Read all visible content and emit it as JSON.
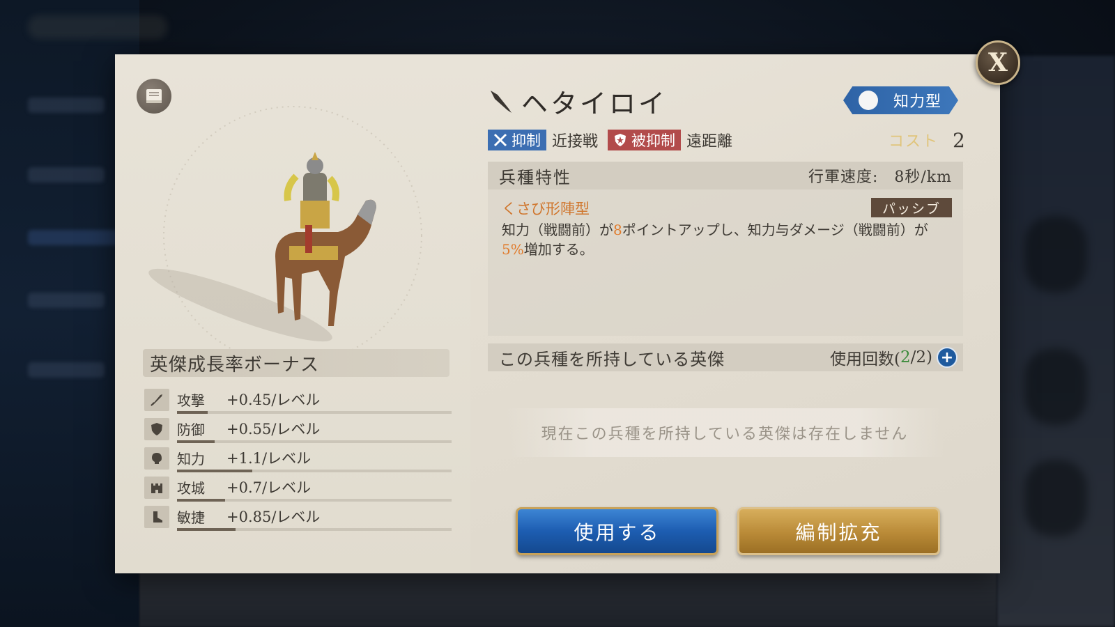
{
  "unit": {
    "name": "ヘタイロイ",
    "type_label": "知力型",
    "advantage_label": "抑制",
    "advantage_target": "近接戦",
    "disadvantage_label": "被抑制",
    "disadvantage_target": "遠距離",
    "cost_label": "コスト",
    "cost_value": "2"
  },
  "trait": {
    "title": "兵種特性",
    "speed": "行軍速度:　8秒/km",
    "skill_name": "くさび形陣型",
    "skill_kind": "パッシブ",
    "desc_part1": "知力（戦闘前）が",
    "desc_num1": "8",
    "desc_part2": "ポイントアップし、知力与ダメージ（戦闘前）が",
    "desc_num2": "5%",
    "desc_part3": "増加する。"
  },
  "owners": {
    "title": "この兵種を所持している英傑",
    "uses_prefix": "使用回数(",
    "uses_current": "2",
    "uses_sep": "/",
    "uses_max": "2",
    "uses_suffix": ")",
    "empty_message": "現在この兵種を所持している英傑は存在しません"
  },
  "growth": {
    "title": "英傑成長率ボーナス",
    "stats": [
      {
        "name": "攻撃",
        "value": "+0.45/レベル",
        "icon": "sword-icon",
        "level": 0.45
      },
      {
        "name": "防御",
        "value": "+0.55/レベル",
        "icon": "shield-icon",
        "level": 0.55
      },
      {
        "name": "知力",
        "value": "+1.1/レベル",
        "icon": "head-icon",
        "level": 1.1
      },
      {
        "name": "攻城",
        "value": "+0.7/レベル",
        "icon": "castle-icon",
        "level": 0.7
      },
      {
        "name": "敏捷",
        "value": "+0.85/レベル",
        "icon": "boot-icon",
        "level": 0.85
      }
    ]
  },
  "buttons": {
    "use": "使用する",
    "expand": "編制拡充",
    "close": "X"
  },
  "colors": {
    "type_badge": "#2e63a6",
    "advantage": "#3c6eb2",
    "disadvantage": "#b24b4b",
    "highlight": "#e07a2a",
    "use_button": "#1d5db1",
    "expand_button": "#b98a37"
  }
}
